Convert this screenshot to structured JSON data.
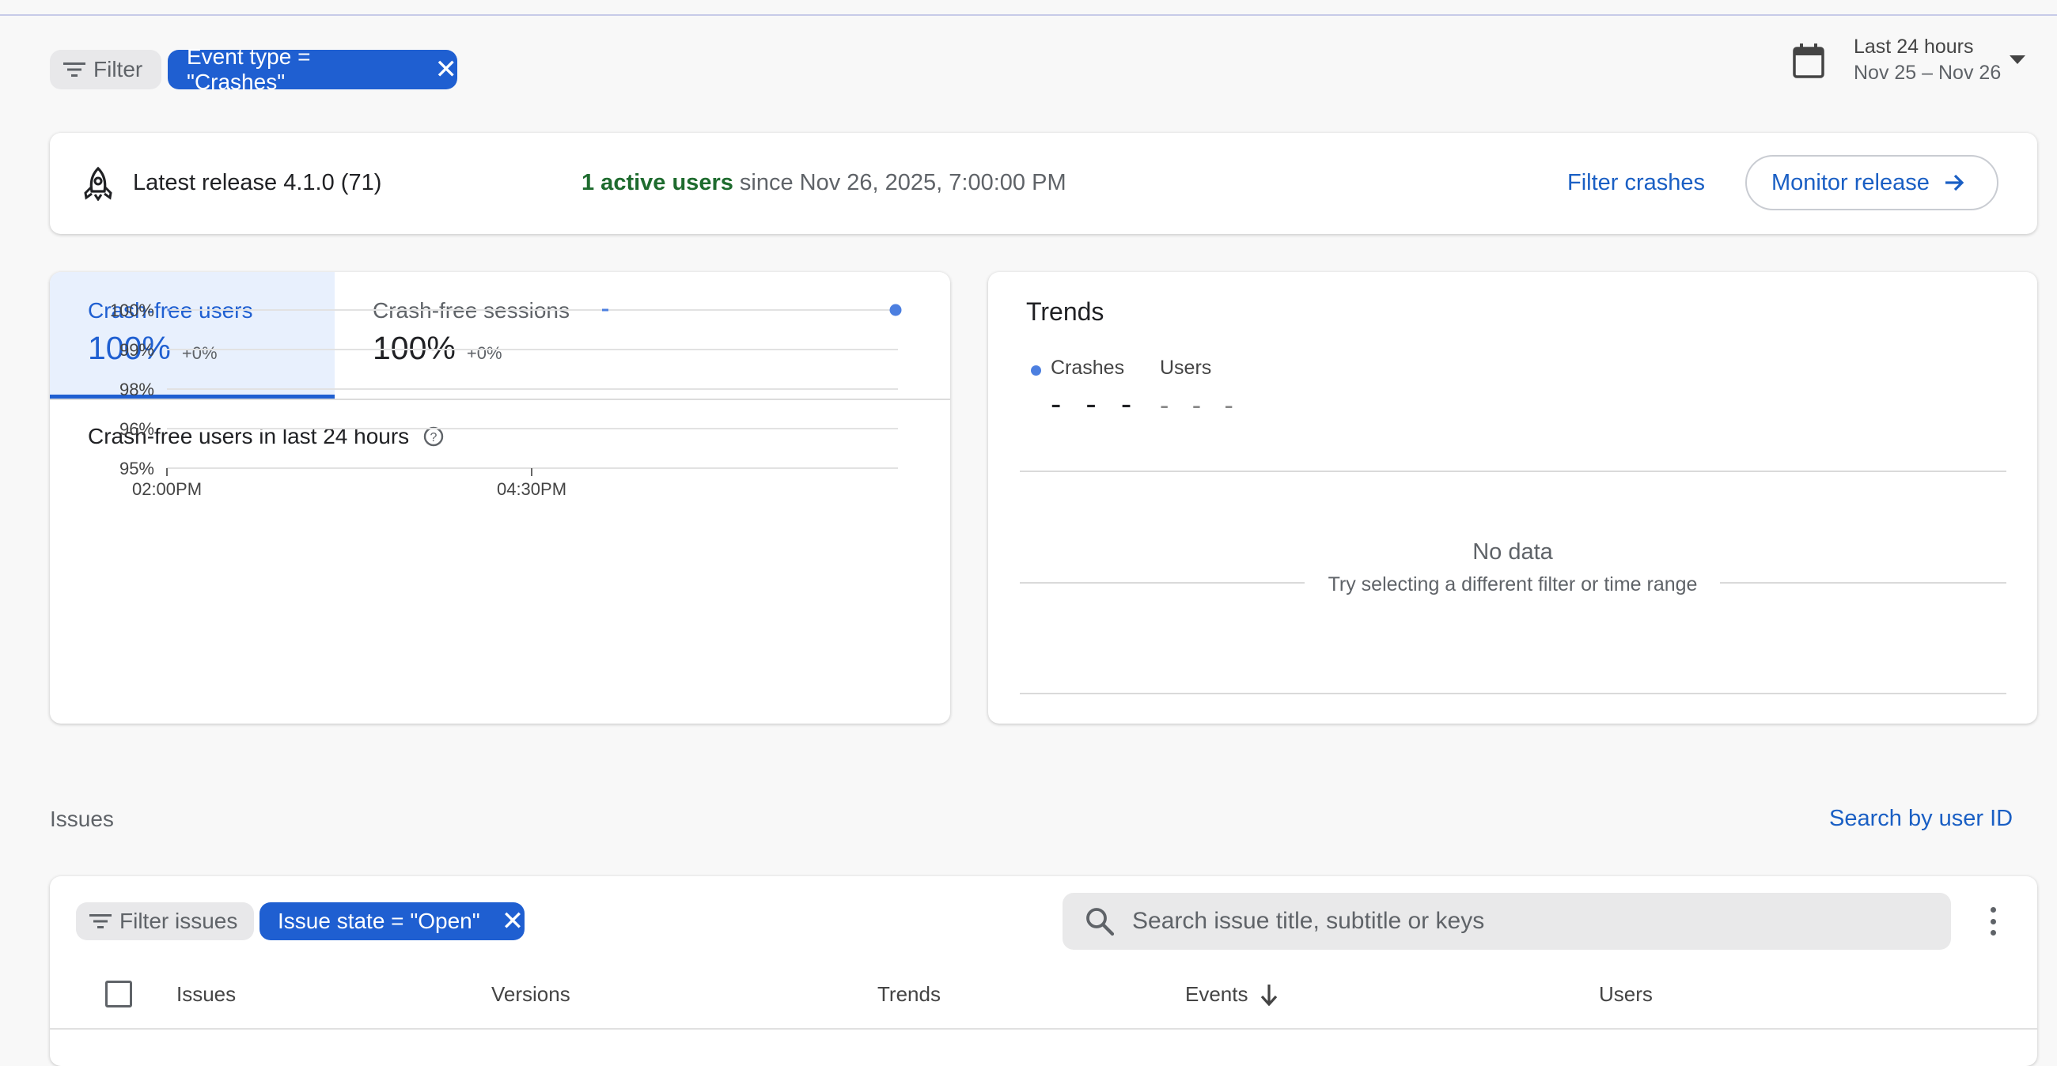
{
  "filters": {
    "filter_label": "Filter",
    "event_chip": "Event type = \"Crashes\""
  },
  "date_range": {
    "title": "Last 24 hours",
    "subtitle": "Nov 25 – Nov 26"
  },
  "release": {
    "label": "Latest release 4.1.0 (71)",
    "active_users_strong": "1 active users",
    "active_users_rest": " since Nov 26, 2025, 7:00:00 PM",
    "filter_crashes": "Filter crashes",
    "monitor_release": "Monitor release"
  },
  "crash_free": {
    "tabs": [
      {
        "label": "Crash-free users",
        "value": "100%",
        "delta": "+0%",
        "selected": true
      },
      {
        "label": "Crash-free sessions",
        "value": "100%",
        "delta": "+0%",
        "selected": false
      }
    ],
    "chart_title": "Crash-free users in last 24 hours"
  },
  "chart_data": {
    "type": "line",
    "title": "Crash-free users in last 24 hours",
    "y_ticks": [
      "100%",
      "99%",
      "98%",
      "96%",
      "95%"
    ],
    "x_ticks": [
      "02:00PM",
      "04:30PM"
    ],
    "series": [
      {
        "values": [
          100,
          100,
          100
        ]
      }
    ],
    "grid": true,
    "accent": "#4c7fe0"
  },
  "trends": {
    "title": "Trends",
    "legend": [
      {
        "label": "Crashes",
        "value": "- - -",
        "color": "#4c7fe0"
      },
      {
        "label": "Users",
        "value": "- - -"
      }
    ],
    "no_data_title": "No data",
    "no_data_sub": "Try selecting a different filter or time range"
  },
  "issues": {
    "heading": "Issues",
    "search_user": "Search by user ID",
    "filter_label": "Filter issues",
    "state_chip": "Issue state = \"Open\"",
    "search_placeholder": "Search issue title, subtitle or keys",
    "columns": [
      "Issues",
      "Versions",
      "Trends",
      "Events",
      "Users"
    ]
  },
  "colors": {
    "primary": "#1f5fd1",
    "link": "#1a5fc4",
    "active_green": "#1e6b2e"
  }
}
